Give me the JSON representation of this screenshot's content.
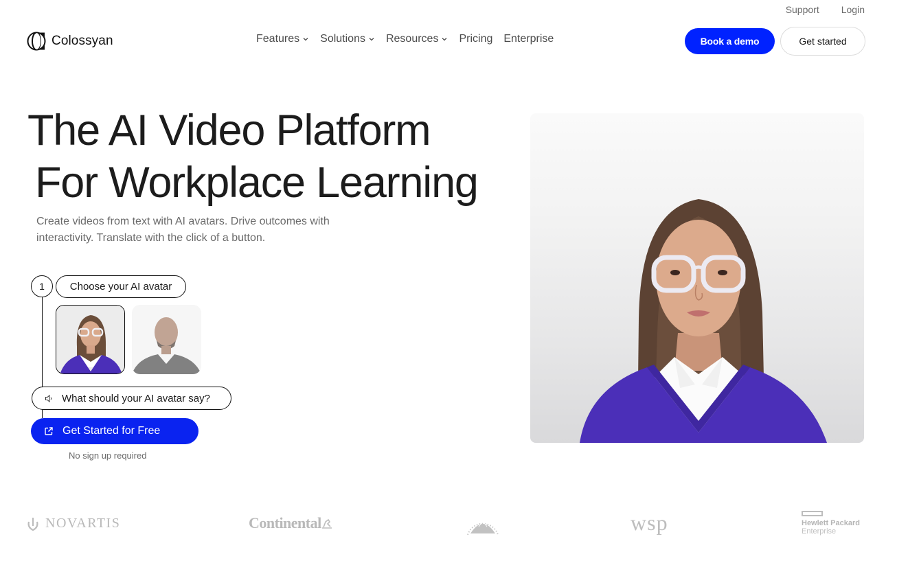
{
  "utility_nav": {
    "support": "Support",
    "login": "Login"
  },
  "header": {
    "brand": "Colossyan",
    "nav": [
      {
        "label": "Features",
        "has_dropdown": true
      },
      {
        "label": "Solutions",
        "has_dropdown": true
      },
      {
        "label": "Resources",
        "has_dropdown": true
      },
      {
        "label": "Pricing",
        "has_dropdown": false
      },
      {
        "label": "Enterprise",
        "has_dropdown": false
      }
    ],
    "book_demo": "Book a demo",
    "get_started": "Get started"
  },
  "hero": {
    "title_line1": "The AI Video Platform",
    "title_line2": "For Workplace Learning",
    "subtitle": "Create videos from text with AI avatars. Drive outcomes with interactivity. Translate with the click of a button.",
    "step_number": "1",
    "step_label": "Choose your AI avatar",
    "avatars": [
      {
        "name": "female-avatar-glasses",
        "selected": true
      },
      {
        "name": "male-avatar",
        "selected": false
      }
    ],
    "script_prompt": "What should your AI avatar say?",
    "cta": "Get Started for Free",
    "cta_note": "No sign up required"
  },
  "logos": {
    "novartis": "NOVARTIS",
    "continental": "Continental",
    "paramount": "Paramount",
    "wsp": "wsp",
    "hpe_line1": "Hewlett Packard",
    "hpe_line2": "Enterprise"
  },
  "colors": {
    "primary_blue": "#0022ff",
    "text_dark": "#1c1c1c",
    "text_muted": "#6a6a6a",
    "logo_gray": "#b9b9b9",
    "sweater_purple": "#4b2fb8"
  }
}
